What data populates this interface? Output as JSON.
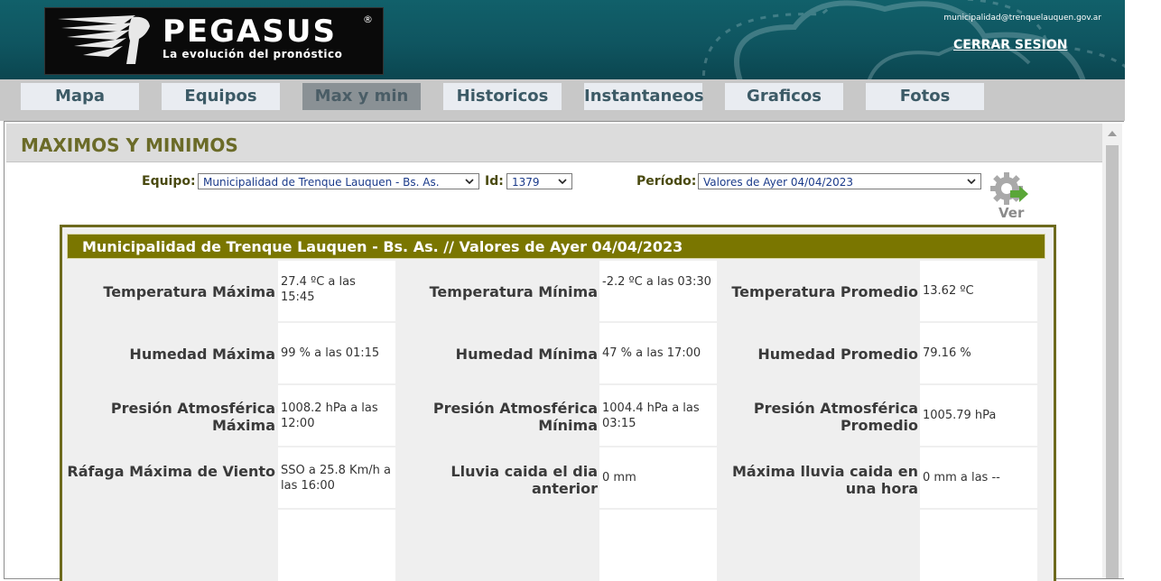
{
  "header": {
    "logo_title": "PEGASUS",
    "logo_reg": "®",
    "logo_subtitle": "La evolución del pronóstico",
    "user_email": "municipalidad@trenquelauquen.gov.ar",
    "logout_label": "CERRAR SESION"
  },
  "nav": {
    "tabs": [
      {
        "label": "Mapa"
      },
      {
        "label": "Equipos"
      },
      {
        "label": "Max y min",
        "active": true
      },
      {
        "label": "Historicos"
      },
      {
        "label": "Instantaneos"
      },
      {
        "label": "Graficos"
      },
      {
        "label": "Fotos"
      }
    ]
  },
  "page": {
    "title": "MAXIMOS Y MINIMOS"
  },
  "filters": {
    "equipo_label": "Equipo:",
    "equipo_value": "Municipalidad de Trenque Lauquen - Bs. As.",
    "id_label": "Id:",
    "id_value": "1379",
    "periodo_label": "Período:",
    "periodo_value": "Valores de Ayer 04/04/2023",
    "ver_label": "Ver"
  },
  "panel": {
    "title": "Municipalidad de Trenque Lauquen - Bs. As. // Valores de Ayer 04/04/2023",
    "rows": [
      [
        {
          "label": "Temperatura Máxima",
          "value": "27.4 ºC a las 15:45"
        },
        {
          "label": "Temperatura Mínima",
          "value": "-2.2 ºC a las 03:30"
        },
        {
          "label": "Temperatura Promedio",
          "value": "13.62 ºC"
        }
      ],
      [
        {
          "label": "Humedad Máxima",
          "value": "99 % a las 01:15"
        },
        {
          "label": "Humedad Mínima",
          "value": "47 % a las 17:00"
        },
        {
          "label": "Humedad Promedio",
          "value": "79.16 %"
        }
      ],
      [
        {
          "label": "Presión Atmosférica Máxima",
          "value": "1008.2 hPa a las 12:00"
        },
        {
          "label": "Presión Atmosférica Mínima",
          "value": "1004.4 hPa a las 03:15"
        },
        {
          "label": "Presión Atmosférica Promedio",
          "value": "1005.79 hPa"
        }
      ],
      [
        {
          "label": "Ráfaga Máxima de Viento",
          "value": "SSO a 25.8 Km/h a las 16:00"
        },
        {
          "label": "Lluvia caida el dia anterior",
          "value": "0 mm"
        },
        {
          "label": "Máxima lluvia caida en una hora",
          "value": "0 mm a las --"
        }
      ]
    ]
  },
  "colors": {
    "header_bg": "#0f5560",
    "nav_bg": "#c8c8c8",
    "tab_bg": "#e9ecf1",
    "tab_active_bg": "#8a9195",
    "title_color": "#6b6b28",
    "panel_border": "#6d6a1d",
    "panel_head_bg": "#7a7600"
  }
}
